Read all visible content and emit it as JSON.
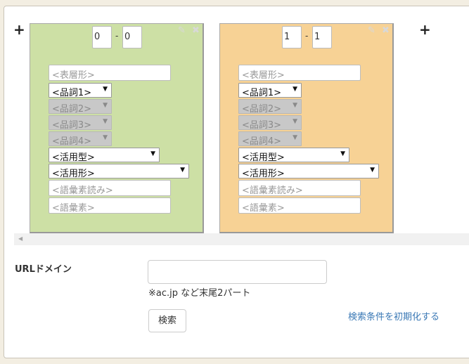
{
  "columns": [
    {
      "range_from": "0",
      "range_to": "0",
      "surface_placeholder": "<表層形>",
      "pos1": "<品詞1>",
      "pos2": "<品詞2>",
      "pos3": "<品詞3>",
      "pos4": "<品詞4>",
      "conj_type": "<活用型>",
      "conj_form": "<活用形>",
      "lemma_reading_placeholder": "<語彙素読み>",
      "lemma_placeholder": "<語彙素>"
    },
    {
      "range_from": "1",
      "range_to": "1",
      "surface_placeholder": "<表層形>",
      "pos1": "<品詞1>",
      "pos2": "<品詞2>",
      "pos3": "<品詞3>",
      "pos4": "<品詞4>",
      "conj_type": "<活用型>",
      "conj_form": "<活用形>",
      "lemma_reading_placeholder": "<語彙素読み>",
      "lemma_placeholder": "<語彙素>"
    }
  ],
  "add_symbol": "+",
  "range_separator": "-",
  "dropdown_arrow": "▼",
  "scroll_left_arrow": "◀",
  "icons": {
    "edit": "pencil-icon",
    "close": "close-icon",
    "add": "plus-icon"
  },
  "colors": {
    "left_box": "#cde0a5",
    "right_box": "#f7d295",
    "link": "#3a78b5"
  },
  "url_domain": {
    "label": "URLドメイン",
    "value": "",
    "hint": "※ac.jp など末尾2パート"
  },
  "search_button": "検索",
  "reset_link": "検索条件を初期化する"
}
